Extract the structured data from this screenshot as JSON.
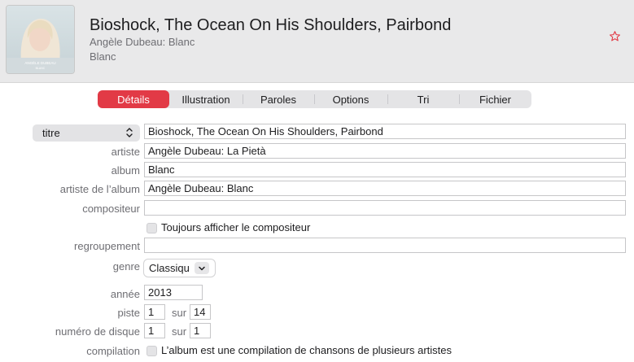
{
  "header": {
    "title": "Bioshock, The Ocean On His Shoulders, Pairbond",
    "artist": "Angèle Dubeau: Blanc",
    "album": "Blanc",
    "artwork_text": "ANGÈLE DUBEAU",
    "artwork_subtext": "BLANC"
  },
  "tabs": [
    "Détails",
    "Illustration",
    "Paroles",
    "Options",
    "Tri",
    "Fichier"
  ],
  "active_tab": "Détails",
  "fields": {
    "title_selector": "titre",
    "title_value": "Bioshock, The Ocean On His Shoulders, Pairbond",
    "artist_label": "artiste",
    "artist_value": "Angèle Dubeau: La Pietà",
    "album_label": "album",
    "album_value": "Blanc",
    "album_artist_label": "artiste de l’album",
    "album_artist_value": "Angèle Dubeau: Blanc",
    "composer_label": "compositeur",
    "composer_value": "",
    "show_composer_label": "Toujours afficher le compositeur",
    "grouping_label": "regroupement",
    "grouping_value": "",
    "genre_label": "genre",
    "genre_value": "Classiqu",
    "year_label": "année",
    "year_value": "2013",
    "track_label": "piste",
    "track_value": "1",
    "track_of_label": "sur",
    "track_total": "14",
    "disc_label": "numéro de disque",
    "disc_value": "1",
    "disc_of_label": "sur",
    "disc_total": "1",
    "compilation_label": "compilation",
    "compilation_text": "L’album est une compilation de chansons de plusieurs artistes"
  },
  "colors": {
    "accent": "#e23a46",
    "header_bg": "#e9e9ea",
    "label": "#6e6e73"
  },
  "icons": {
    "star": "star-icon",
    "popup_chevron": "chevron-up-down-icon",
    "genre_chevron": "chevron-down-icon"
  }
}
